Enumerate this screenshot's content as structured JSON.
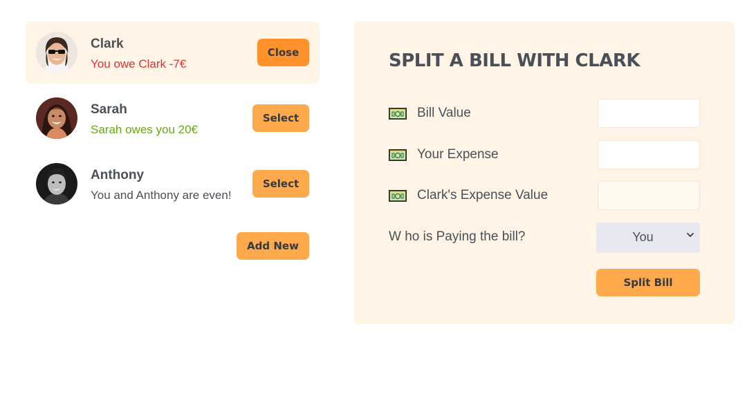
{
  "friends": [
    {
      "name": "Clark",
      "status": "You owe Clark -7€",
      "status_type": "red",
      "button": "Close",
      "selected": true
    },
    {
      "name": "Sarah",
      "status": "Sarah owes you 20€",
      "status_type": "green",
      "button": "Select",
      "selected": false
    },
    {
      "name": "Anthony",
      "status": "You and Anthony are even!",
      "status_type": "neutral",
      "button": "Select",
      "selected": false
    }
  ],
  "add_new_label": "Add New",
  "form": {
    "title": "SPLIT A BILL WITH CLARK",
    "bill_value_label": "Bill Value",
    "bill_value": "",
    "your_expense_label": "Your Expense",
    "your_expense": "",
    "friend_expense_label": "Clark's Expense Value",
    "friend_expense": "",
    "payer_label": "W ho is Paying the bill?",
    "payer_selected": "You",
    "submit_label": "Split Bill",
    "icon": "money-icon"
  },
  "colors": {
    "accent": "#ffa94d",
    "accent_dark": "#ff922b",
    "panel_bg": "#fff4e6",
    "red": "#e03131",
    "green": "#66a80f"
  }
}
